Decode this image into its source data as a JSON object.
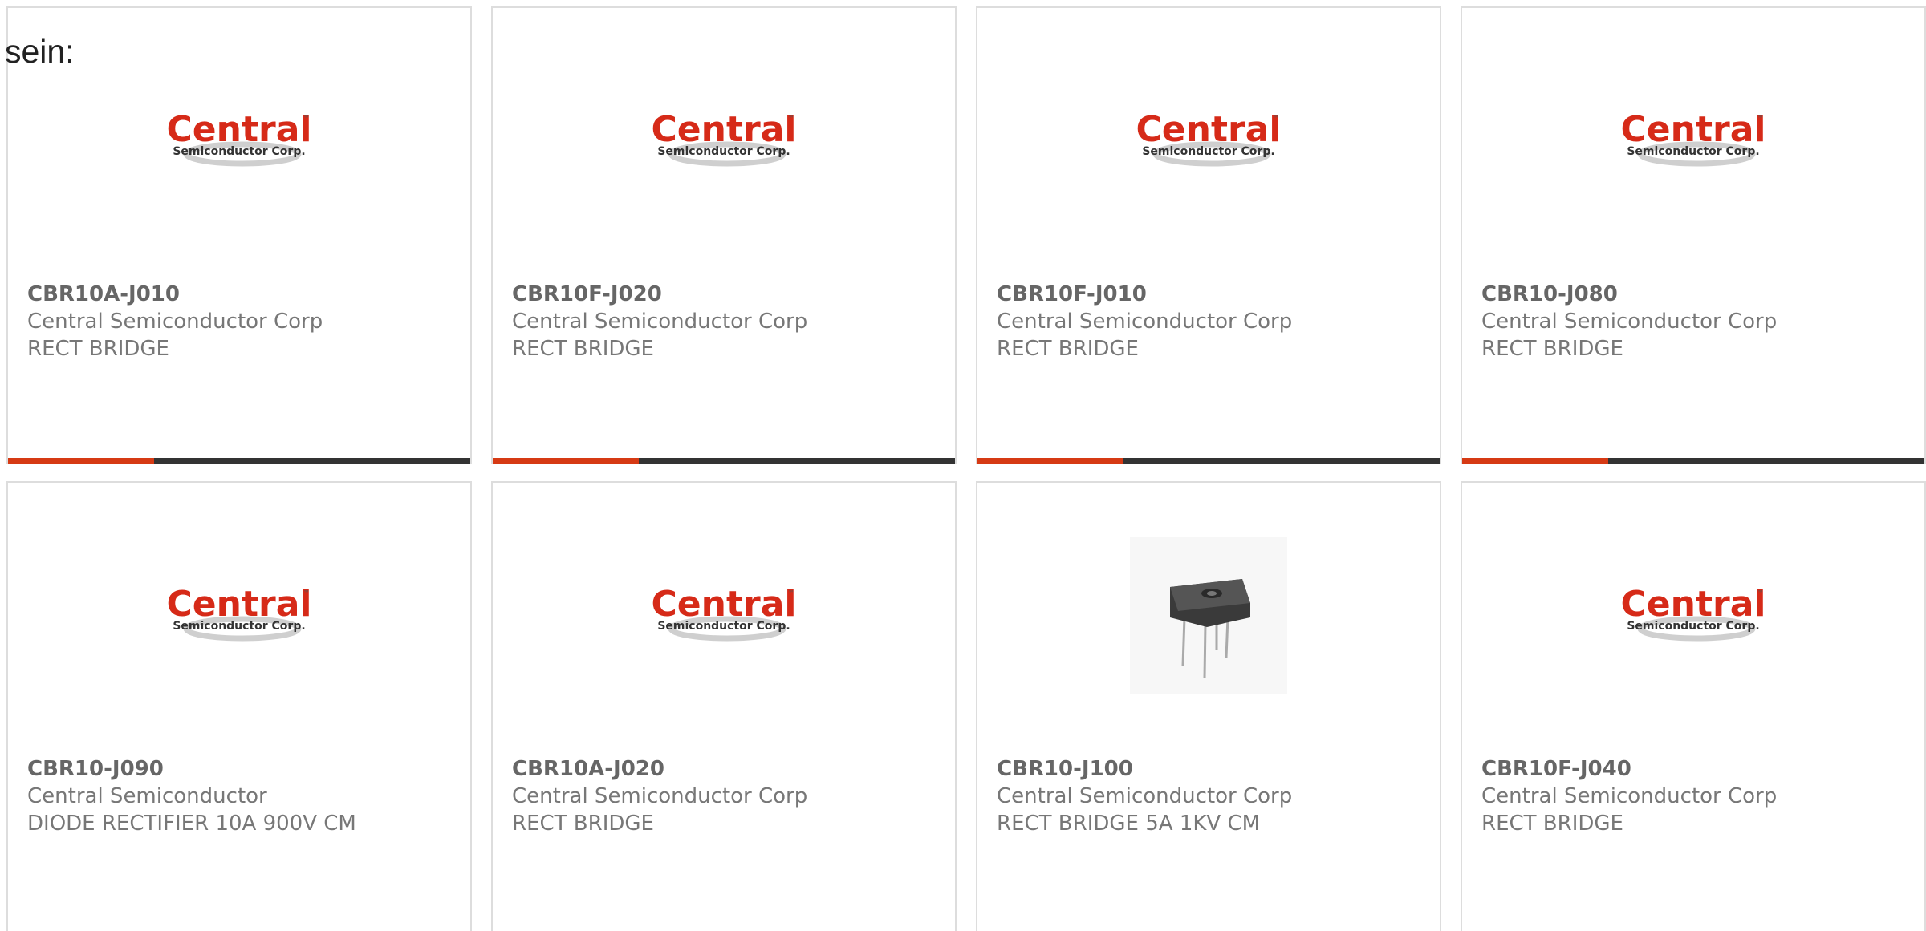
{
  "intro_text": "sein:",
  "logo": {
    "word": "Central",
    "tm": "™",
    "sub": "Semiconductor Corp."
  },
  "colors": {
    "logo_red": "#d62a18",
    "accent_bar": "#d63a14",
    "bar_dark": "#333333",
    "text_gray": "#777777"
  },
  "products": [
    {
      "part": "CBR10A-J010",
      "manufacturer": "Central Semiconductor Corp",
      "description": "RECT BRIDGE",
      "image": "central-logo"
    },
    {
      "part": "CBR10F-J020",
      "manufacturer": "Central Semiconductor Corp",
      "description": "RECT BRIDGE",
      "image": "central-logo"
    },
    {
      "part": "CBR10F-J010",
      "manufacturer": "Central Semiconductor Corp",
      "description": "RECT BRIDGE",
      "image": "central-logo"
    },
    {
      "part": "CBR10-J080",
      "manufacturer": "Central Semiconductor Corp",
      "description": "RECT BRIDGE",
      "image": "central-logo"
    },
    {
      "part": "CBR10-J090",
      "manufacturer": "Central Semiconductor",
      "description": "DIODE RECTIFIER 10A 900V CM",
      "image": "central-logo"
    },
    {
      "part": "CBR10A-J020",
      "manufacturer": "Central Semiconductor Corp",
      "description": "RECT BRIDGE",
      "image": "central-logo"
    },
    {
      "part": "CBR10-J100",
      "manufacturer": "Central Semiconductor Corp",
      "description": "RECT BRIDGE 5A 1KV CM",
      "image": "bridge-rectifier-photo"
    },
    {
      "part": "CBR10F-J040",
      "manufacturer": "Central Semiconductor Corp",
      "description": "RECT BRIDGE",
      "image": "central-logo"
    }
  ]
}
